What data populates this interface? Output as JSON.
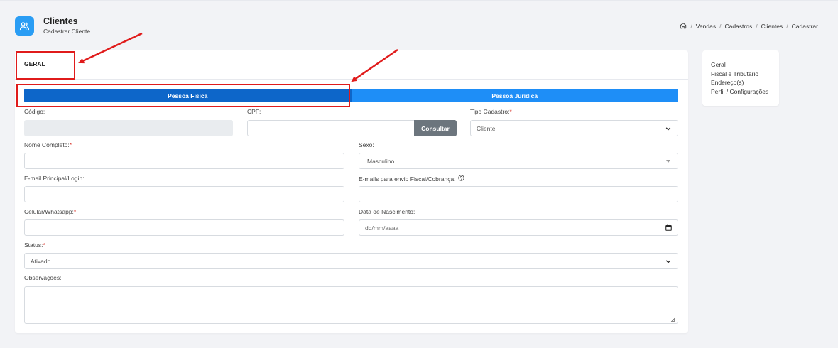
{
  "header": {
    "title": "Clientes",
    "subtitle": "Cadastrar Cliente"
  },
  "breadcrumb": {
    "items": [
      "Vendas",
      "Cadastros",
      "Clientes",
      "Cadastrar"
    ],
    "separator": "/"
  },
  "tabs": {
    "geral": "GERAL"
  },
  "person_type": {
    "fisica": "Pessoa Física",
    "juridica": "Pessoa Jurídica",
    "selected": "Pessoa Física"
  },
  "form": {
    "codigo": {
      "label": "Código:",
      "value": ""
    },
    "cpf": {
      "label": "CPF:",
      "value": "",
      "button": "Consultar"
    },
    "tipo_cadastro": {
      "label": "Tipo Cadastro:",
      "required_mark": "*",
      "value": "Cliente"
    },
    "nome": {
      "label": "Nome Completo:",
      "required_mark": "*",
      "value": ""
    },
    "sexo": {
      "label": "Sexo:",
      "value": "Masculino"
    },
    "email": {
      "label": "E-mail Principal/Login:",
      "value": ""
    },
    "emails_envio": {
      "label": "E-mails para envio Fiscal/Cobrança:",
      "value": ""
    },
    "celular": {
      "label": "Celular/Whatsapp:",
      "required_mark": "*",
      "value": ""
    },
    "nascimento": {
      "label": "Data de Nascimento:",
      "placeholder": "dd/mm/aaaa"
    },
    "status": {
      "label": "Status:",
      "required_mark": "*",
      "value": "Ativado"
    },
    "observacoes": {
      "label": "Observações:",
      "value": ""
    }
  },
  "side_nav": {
    "items": [
      "Geral",
      "Fiscal e Tributário",
      "Endereço(s)",
      "Perfil / Configurações"
    ]
  },
  "colors": {
    "primary_active": "#0d66c9",
    "primary": "#1e8ef7",
    "icon_bg": "#2a9df4",
    "required": "#d9342b",
    "annotation": "#e01b1b",
    "secondary_button": "#6c757d"
  },
  "icons": {
    "header": "users-icon",
    "breadcrumb_home": "home-icon",
    "help": "question-circle-icon",
    "calendar": "calendar-icon",
    "chevron": "chevron-down-icon"
  }
}
